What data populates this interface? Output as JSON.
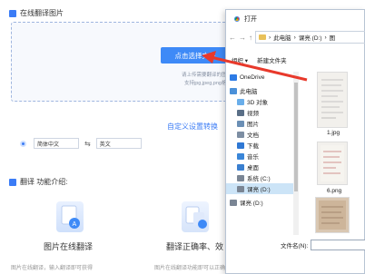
{
  "upload": {
    "section_title": "在线翻译图片",
    "button_label": "点击选择文件",
    "hint_line": "请上传需要翻译的图片",
    "formats_line": "支持jpg,jpeg,png格式"
  },
  "language": {
    "custom_link": "自定义设置转换",
    "source": "简体中文",
    "target": "英文"
  },
  "features": {
    "section_title": "翻译 功能介绍:",
    "items": [
      {
        "name": "图片在线翻译",
        "desc": "图片在线翻译，输入翻译即可获得"
      },
      {
        "name": "翻译正确率、效",
        "desc": "图片在线翻译功能即可以正确方便"
      }
    ]
  },
  "dialog": {
    "title": "打开",
    "breadcrumb": [
      "此电脑",
      "课亮 (D:)",
      "图"
    ],
    "toolbar": {
      "organize": "组织 ▾",
      "new_folder": "新建文件夹"
    },
    "nav_items": [
      {
        "label": "OneDrive",
        "icon": "cloud-icon",
        "color": "#2d7be5"
      },
      {
        "label": "此电脑",
        "icon": "computer-icon",
        "color": "#4a90d9"
      },
      {
        "label": "3D 对象",
        "icon": "cube-icon",
        "color": "#6aaeea"
      },
      {
        "label": "视频",
        "icon": "video-icon",
        "color": "#5a6f87"
      },
      {
        "label": "图片",
        "icon": "picture-icon",
        "color": "#6b8fb5"
      },
      {
        "label": "文档",
        "icon": "document-icon",
        "color": "#7d8ea3"
      },
      {
        "label": "下载",
        "icon": "download-icon",
        "color": "#2f78d4"
      },
      {
        "label": "音乐",
        "icon": "music-icon",
        "color": "#3a86d8"
      },
      {
        "label": "桌面",
        "icon": "desktop-icon",
        "color": "#3a7fd0"
      },
      {
        "label": "系统 (C:)",
        "icon": "drive-icon",
        "color": "#7a8594"
      },
      {
        "label": "课亮 (D:)",
        "icon": "drive-icon",
        "color": "#7a8594",
        "selected": true
      },
      {
        "label": "课亮 (D:)",
        "icon": "drive-icon",
        "color": "#7a8594"
      }
    ],
    "files": [
      {
        "label": "1.jpg"
      },
      {
        "label": "6.png"
      },
      {
        "label": ""
      }
    ],
    "filename_label": "文件名(N):"
  },
  "colors": {
    "accent": "#3e8af7",
    "arrow": "#e8392b"
  }
}
